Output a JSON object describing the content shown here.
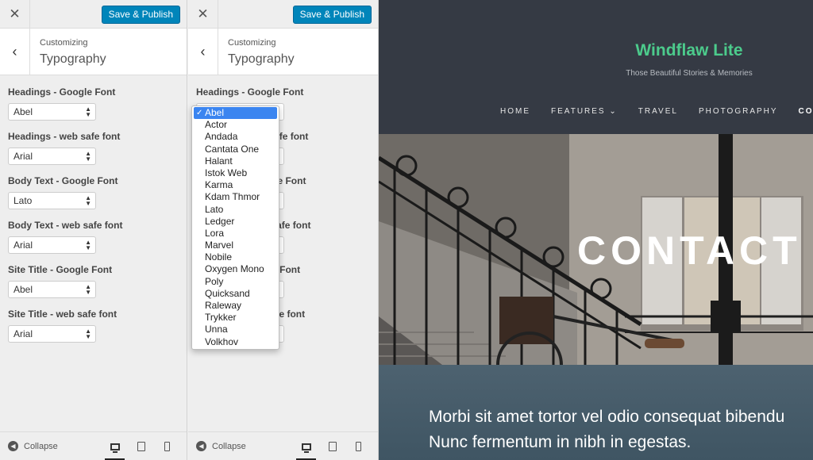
{
  "customizer": {
    "close_glyph": "✕",
    "publish_label": "Save & Publish",
    "back_glyph": "‹",
    "customizing_label": "Customizing",
    "section_title": "Typography",
    "collapse_label": "Collapse",
    "devices": [
      "desktop-icon",
      "tablet-icon",
      "mobile-icon"
    ],
    "active_device": "desktop"
  },
  "controls": [
    {
      "label": "Headings - Google Font",
      "value": "Abel"
    },
    {
      "label": "Headings - web safe font",
      "value": "Arial"
    },
    {
      "label": "Body Text - Google Font",
      "value": "Lato"
    },
    {
      "label": "Body Text - web safe font",
      "value": "Arial"
    },
    {
      "label": "Site Title - Google Font",
      "value": "Abel"
    },
    {
      "label": "Site Title - web safe font",
      "value": "Arial"
    }
  ],
  "dropdown": {
    "selected": "Abel",
    "options": [
      "Abel",
      "Actor",
      "Andada",
      "Cantata One",
      "Halant",
      "Istok Web",
      "Karma",
      "Kdam Thmor",
      "Lato",
      "Ledger",
      "Lora",
      "Marvel",
      "Nobile",
      "Oxygen Mono",
      "Poly",
      "Quicksand",
      "Raleway",
      "Trykker",
      "Unna",
      "Volkhov"
    ]
  },
  "preview": {
    "site_title": "Windflaw Lite",
    "tagline": "Those Beautiful Stories & Memories",
    "nav": [
      {
        "label": "HOME"
      },
      {
        "label": "FEATURES ⌄"
      },
      {
        "label": "TRAVEL"
      },
      {
        "label": "PHOTOGRAPHY"
      },
      {
        "label": "CONTAC",
        "active": true
      }
    ],
    "hero_title": "CONTACT",
    "body_line1": "Morbi sit amet tortor vel odio consequat bibendu",
    "body_line2": "Nunc fermentum in nibh in egestas.",
    "colors": {
      "accent": "#4ccb8c",
      "publish": "#0085ba",
      "header_bg": "#353a44",
      "select_highlight": "#3b85f0"
    }
  }
}
